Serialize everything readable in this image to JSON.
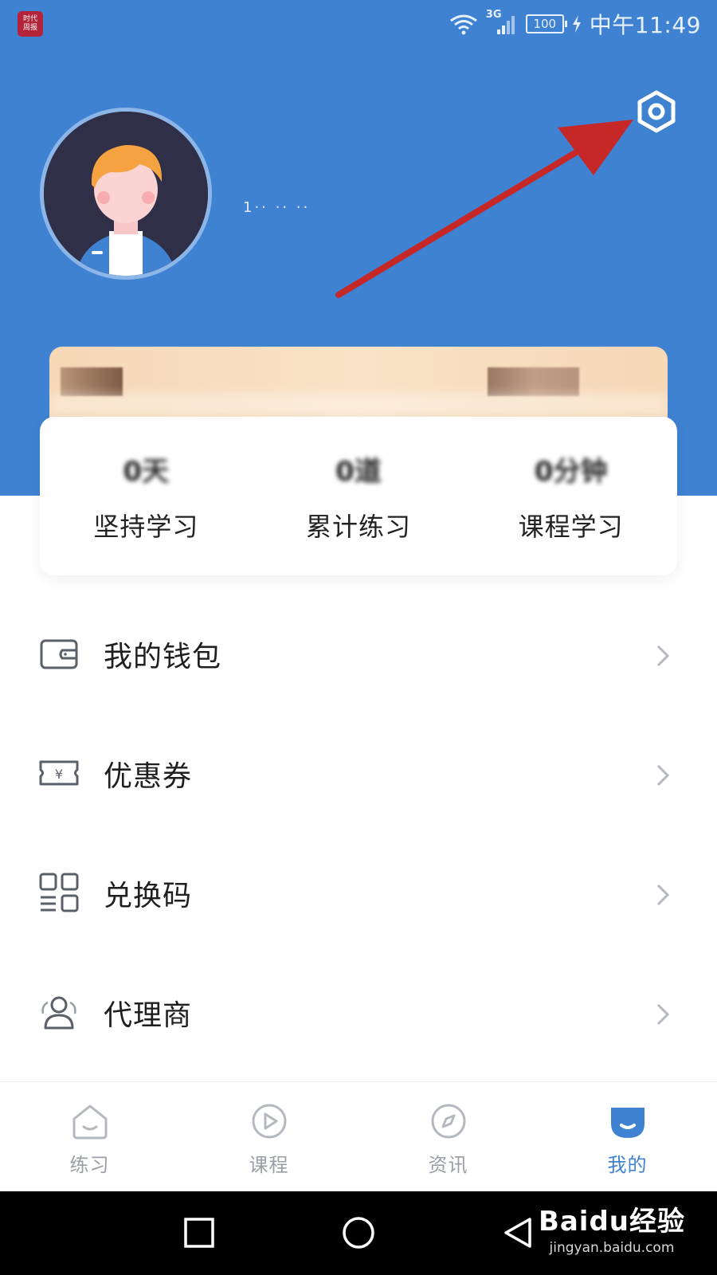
{
  "status_bar": {
    "app_badge": "时代\n周报",
    "network": "3G",
    "battery": "100",
    "time": "中午11:49"
  },
  "profile": {
    "username": "1·· ·· ··"
  },
  "stats": [
    {
      "value": "0天",
      "label": "坚持学习"
    },
    {
      "value": "0道",
      "label": "累计练习"
    },
    {
      "value": "0分钟",
      "label": "课程学习"
    }
  ],
  "menu": [
    {
      "label": "我的钱包",
      "icon": "wallet-icon"
    },
    {
      "label": "优惠券",
      "icon": "coupon-icon"
    },
    {
      "label": "兑换码",
      "icon": "redeem-code-icon"
    },
    {
      "label": "代理商",
      "icon": "agent-icon"
    }
  ],
  "tabs": [
    {
      "label": "练习",
      "icon": "practice-icon",
      "active": false
    },
    {
      "label": "课程",
      "icon": "course-play-icon",
      "active": false
    },
    {
      "label": "资讯",
      "icon": "compass-icon",
      "active": false
    },
    {
      "label": "我的",
      "icon": "profile-icon",
      "active": true
    }
  ],
  "watermark": {
    "brand": "Baidu经验",
    "url": "jingyan.baidu.com"
  },
  "colors": {
    "header_blue": "#3f82d2",
    "annotation_arrow": "#c62828",
    "active_tab": "#3f82d2",
    "inactive_tab": "#9a9ea6"
  }
}
